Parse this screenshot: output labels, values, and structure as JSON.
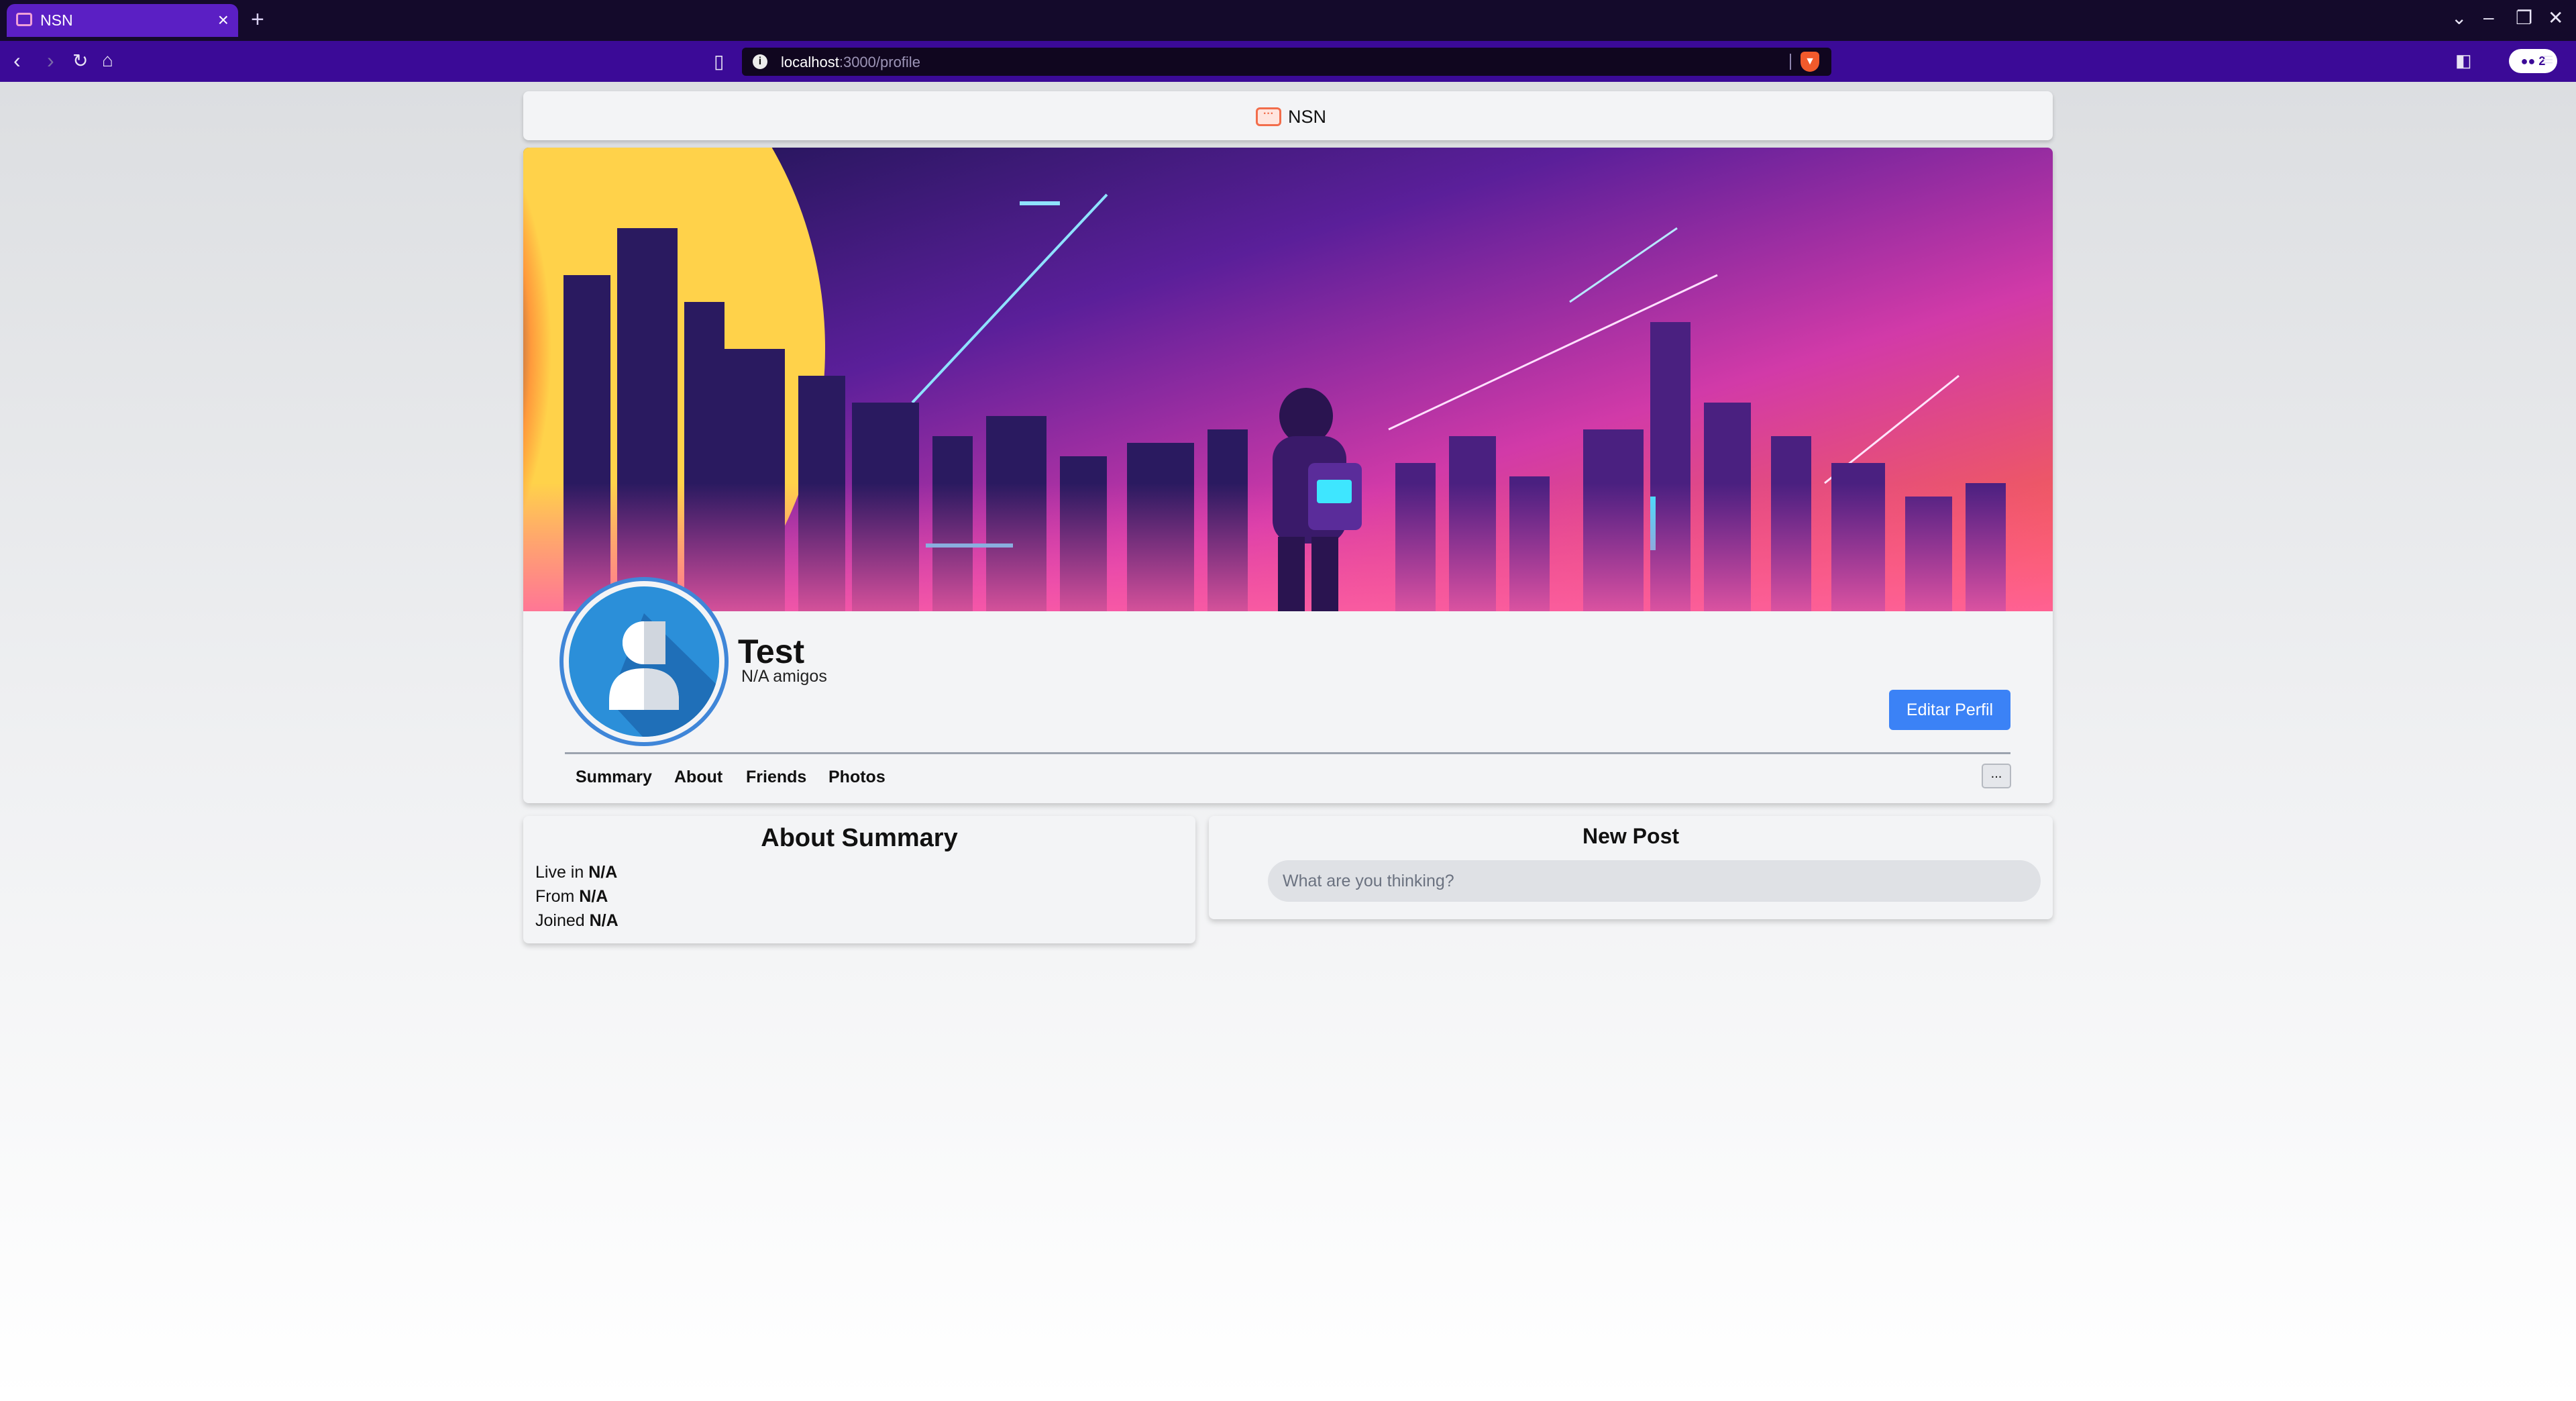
{
  "browser": {
    "tab_title": "NSN",
    "tab_close": "×",
    "new_tab": "+",
    "url_host": "localhost",
    "url_path": ":3000/profile",
    "extension_badge": "2"
  },
  "nav": {
    "brand": "NSN"
  },
  "profile": {
    "name": "Test",
    "friends": "N/A amigos",
    "edit_button": "Editar Perfil",
    "tabs": [
      "Summary",
      "About",
      "Friends",
      "Photos"
    ],
    "more": "..."
  },
  "about": {
    "title": "About Summary",
    "lives_label": "Live in",
    "lives_value": "N/A",
    "from_label": "From",
    "from_value": "N/A",
    "joined_label": "Joined",
    "joined_value": "N/A"
  },
  "post": {
    "title": "New Post",
    "placeholder": "What are you thinking?"
  },
  "colors": {
    "accent": "#3b82f6",
    "browser_tab": "#5b1fc4",
    "browser_toolbar": "#3b0a97",
    "cover_sky_top": "#2a1466",
    "cover_sky_bottom": "#f24eb0"
  },
  "icons": {
    "brand": "chat-bubble-icon",
    "avatar": "user-silhouette-icon"
  }
}
